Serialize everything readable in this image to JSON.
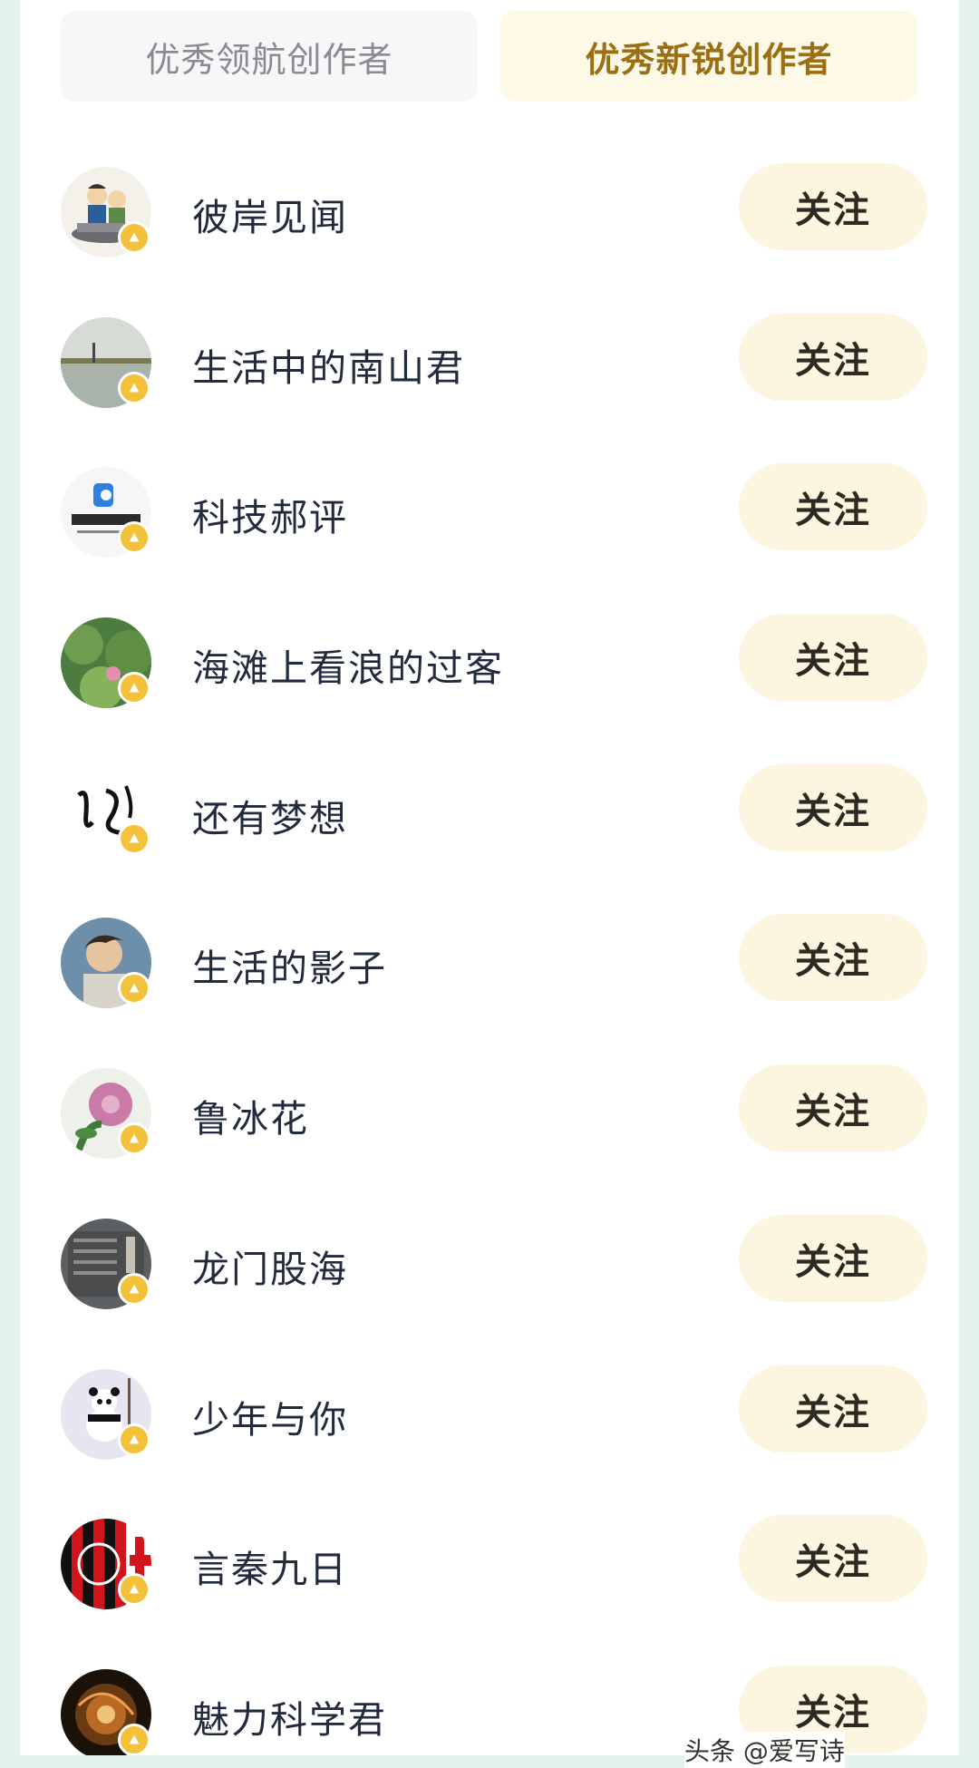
{
  "tabs": [
    {
      "label": "优秀领航创作者",
      "active": false
    },
    {
      "label": "优秀新锐创作者",
      "active": true
    }
  ],
  "creators": [
    {
      "name": "彼岸见闻",
      "follow_label": "关注",
      "avatar_icon": "cartoon-figures-avatar"
    },
    {
      "name": "生活中的南山君",
      "follow_label": "关注",
      "avatar_icon": "lake-scene-avatar"
    },
    {
      "name": "科技郝评",
      "follow_label": "关注",
      "avatar_icon": "keji-haoping-logo-avatar"
    },
    {
      "name": "海滩上看浪的过客",
      "follow_label": "关注",
      "avatar_icon": "lotus-pond-avatar"
    },
    {
      "name": "还有梦想",
      "follow_label": "关注",
      "avatar_icon": "calligraphy-avatar"
    },
    {
      "name": "生活的影子",
      "follow_label": "关注",
      "avatar_icon": "portrait-avatar"
    },
    {
      "name": "鲁冰花",
      "follow_label": "关注",
      "avatar_icon": "pink-flower-avatar"
    },
    {
      "name": "龙门股海",
      "follow_label": "关注",
      "avatar_icon": "stone-wall-avatar"
    },
    {
      "name": "少年与你",
      "follow_label": "关注",
      "avatar_icon": "panda-avatar"
    },
    {
      "name": "言秦九日",
      "follow_label": "关注",
      "avatar_icon": "ac-milan-crest-avatar"
    },
    {
      "name": "魅力科学君",
      "follow_label": "关注",
      "avatar_icon": "galaxy-avatar"
    }
  ],
  "watermark": "头条 @爱写诗",
  "colors": {
    "page_background": "#e4f3ef",
    "active_tab_text": "#9b7014",
    "follow_button_bg": "#fcf5df",
    "badge": "#f3c13a"
  }
}
